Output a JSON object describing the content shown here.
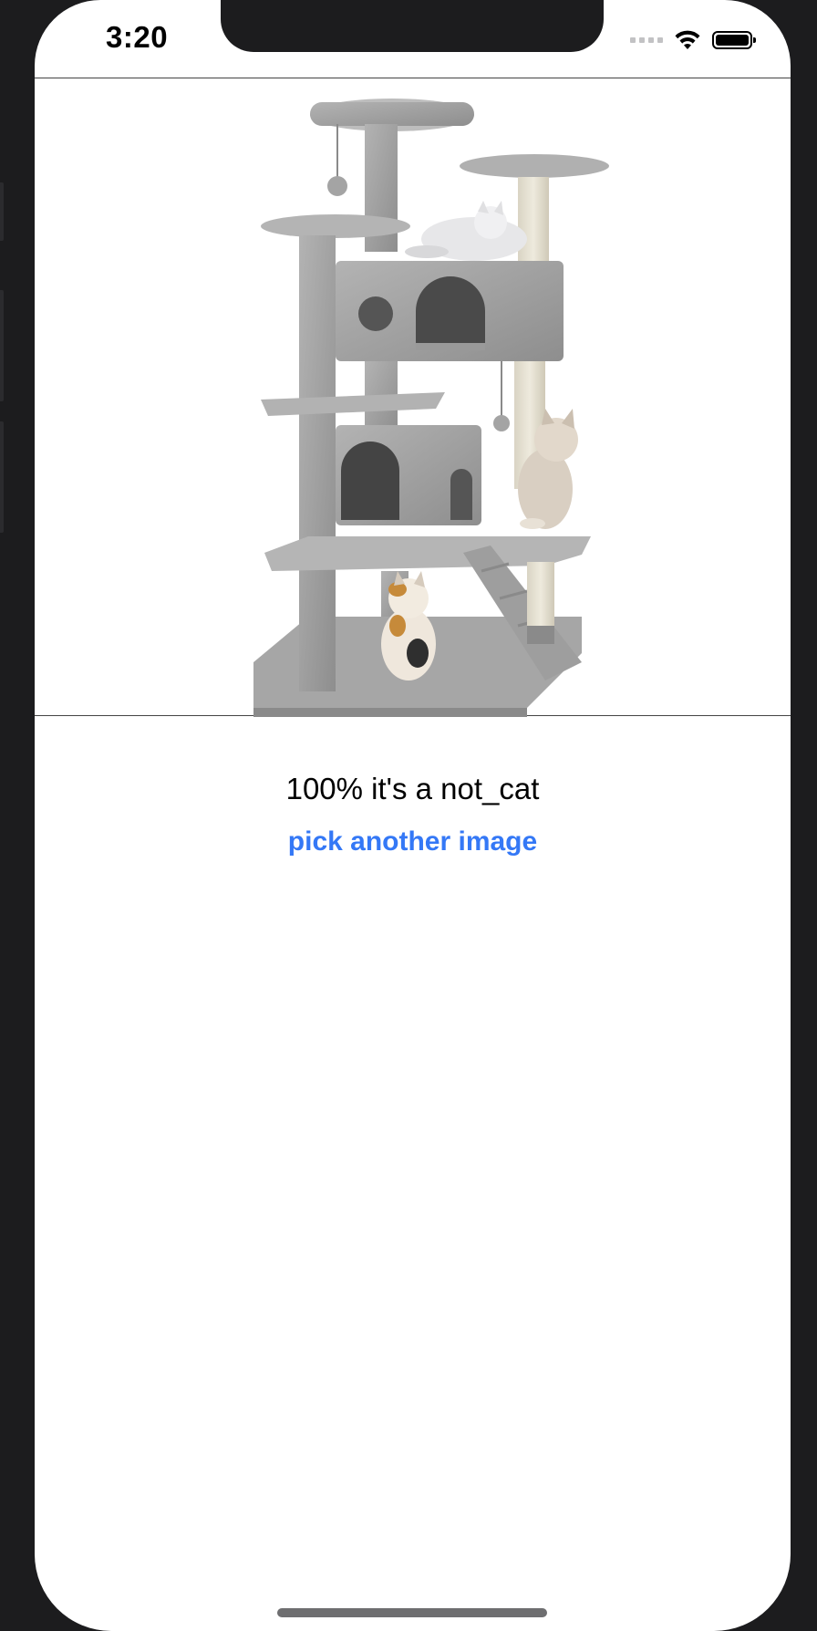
{
  "status_bar": {
    "time": "3:20",
    "icons": [
      "signal-icon",
      "wifi-icon",
      "battery-icon"
    ]
  },
  "image": {
    "description_icon": "cat-tree-photo"
  },
  "result": {
    "text": "100% it's a not_cat"
  },
  "actions": {
    "pick_label": "pick another image"
  },
  "colors": {
    "accent": "#3478f6",
    "background": "#ffffff",
    "device_frame": "#1c1c1e"
  }
}
